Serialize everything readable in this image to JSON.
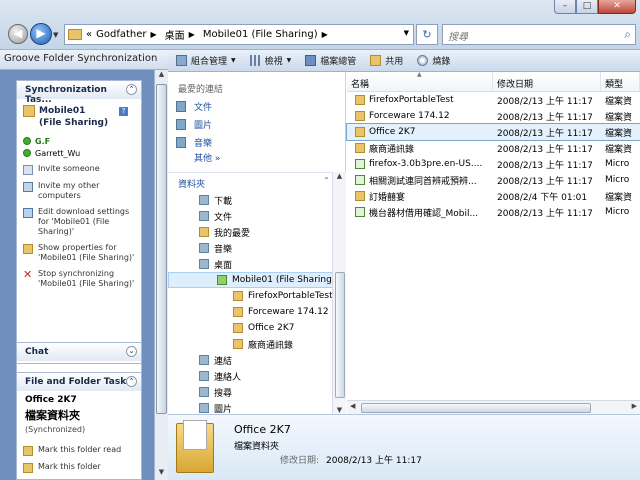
{
  "address": {
    "breadcrumbs": [
      "Godfather",
      "桌面",
      "Mobile01 (File Sharing)"
    ],
    "prefix": "«",
    "search_placeholder": "搜尋"
  },
  "window_controls": {
    "minimize": "–",
    "maximize": "□",
    "close": "✕"
  },
  "groove": {
    "title": "Groove Folder Synchronization",
    "sync_tasks_title": "Synchronization Tas...",
    "workspace_name": "Mobile01 (File Sharing)",
    "members": [
      {
        "name": "G.F",
        "status": "online"
      },
      {
        "name": "Garrett_Wu",
        "status": "online"
      }
    ],
    "tasks": [
      {
        "label": "Invite someone",
        "icon": "invite-icon"
      },
      {
        "label": "Invite my other computers",
        "icon": "computers-icon"
      },
      {
        "label": "Edit download settings for 'Mobile01 (File Sharing)'",
        "icon": "download-settings-icon"
      },
      {
        "label": "Show properties for 'Mobile01 (File Sharing)'",
        "icon": "properties-icon"
      },
      {
        "label": "Stop synchronizing 'Mobile01 (File Sharing)'",
        "icon": "stop-icon"
      }
    ],
    "chat_title": "Chat",
    "file_tasks_title": "File and Folder Tasks",
    "selected_name": "Office 2K7",
    "selected_type": "檔案資料夾",
    "selected_status": "(Synchronized)",
    "file_tasks": [
      {
        "label": "Mark this folder read"
      },
      {
        "label": "Mark this folder"
      }
    ]
  },
  "toolbar": {
    "organize": "組合管理",
    "views": "檢視",
    "explore": "檔案總管",
    "share": "共用",
    "burn": "燒錄"
  },
  "navpane": {
    "favorites_label": "最愛的連結",
    "favorites": [
      "文件",
      "圖片",
      "音樂"
    ],
    "more": "其他",
    "folders_label": "資料夾",
    "tree": [
      {
        "label": "下載",
        "indent": 2,
        "icon": "special"
      },
      {
        "label": "文件",
        "indent": 2,
        "icon": "special"
      },
      {
        "label": "我的最愛",
        "indent": 2,
        "icon": "folder"
      },
      {
        "label": "音樂",
        "indent": 2,
        "icon": "special"
      },
      {
        "label": "桌面",
        "indent": 2,
        "icon": "special"
      },
      {
        "label": "Mobile01 (File Sharing)",
        "indent": 3,
        "icon": "groove",
        "selected": true
      },
      {
        "label": "FirefoxPortableTest",
        "indent": 4,
        "icon": "folder"
      },
      {
        "label": "Forceware 174.12",
        "indent": 4,
        "icon": "folder"
      },
      {
        "label": "Office 2K7",
        "indent": 4,
        "icon": "folder"
      },
      {
        "label": "廠商通訊錄",
        "indent": 4,
        "icon": "folder"
      },
      {
        "label": "連結",
        "indent": 2,
        "icon": "special"
      },
      {
        "label": "連絡人",
        "indent": 2,
        "icon": "special"
      },
      {
        "label": "搜尋",
        "indent": 2,
        "icon": "special"
      },
      {
        "label": "圖片",
        "indent": 2,
        "icon": "special"
      }
    ]
  },
  "filelist": {
    "columns": [
      "名稱",
      "修改日期",
      "類型"
    ],
    "rows": [
      {
        "name": "FirefoxPortableTest",
        "date": "2008/2/13 上午 11:17",
        "type": "檔案資",
        "icon": "folder",
        "selected": false
      },
      {
        "name": "Forceware 174.12",
        "date": "2008/2/13 上午 11:17",
        "type": "檔案資",
        "icon": "folder",
        "selected": false
      },
      {
        "name": "Office 2K7",
        "date": "2008/2/13 上午 11:17",
        "type": "檔案資",
        "icon": "folder",
        "selected": true
      },
      {
        "name": "廠商通訊錄",
        "date": "2008/2/13 上午 11:17",
        "type": "檔案資",
        "icon": "folder",
        "selected": false
      },
      {
        "name": "firefox-3.0b3pre.en-US....",
        "date": "2008/2/13 上午 11:17",
        "type": "Micro",
        "icon": "file",
        "selected": false
      },
      {
        "name": "相關測試連同首辨戒預辨...",
        "date": "2008/2/13 上午 11:17",
        "type": "Micro",
        "icon": "file",
        "selected": false
      },
      {
        "name": "訂婚囍宴",
        "date": "2008/2/4 下午 01:01",
        "type": "檔案資",
        "icon": "folder",
        "selected": false
      },
      {
        "name": "機台器材借用確認_Mobil...",
        "date": "2008/2/13 上午 11:17",
        "type": "Micro",
        "icon": "file",
        "selected": false
      }
    ]
  },
  "details": {
    "name": "Office 2K7",
    "type": "檔案資料夾",
    "modified_label": "修改日期:",
    "modified_value": "2008/2/13 上午 11:17"
  }
}
